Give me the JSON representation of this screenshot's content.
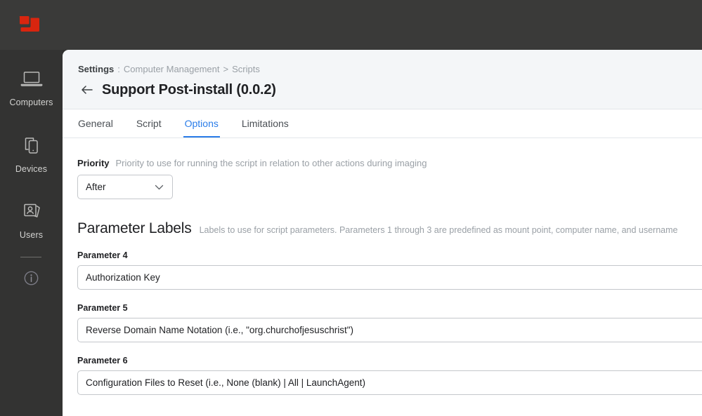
{
  "brand": {
    "logo_icon": "jamf-logo-icon",
    "accent_color": "#d8250f",
    "tab_active_color": "#2b7de9",
    "topbar_color": "#3a3a39",
    "sidebar_color": "#333332"
  },
  "sidebar": {
    "items": [
      {
        "label": "Computers",
        "icon": "laptop-icon"
      },
      {
        "label": "Devices",
        "icon": "mobile-devices-icon"
      },
      {
        "label": "Users",
        "icon": "users-cards-icon"
      }
    ],
    "info_icon": "info-circle-icon"
  },
  "header": {
    "breadcrumb": {
      "root": "Settings",
      "colon": ":",
      "middle": "Computer Management",
      "separator": ">",
      "current": "Scripts"
    },
    "back_icon": "back-arrow-icon",
    "title": "Support Post-install (0.0.2)"
  },
  "tabs": [
    {
      "label": "General",
      "active": false
    },
    {
      "label": "Script",
      "active": false
    },
    {
      "label": "Options",
      "active": true
    },
    {
      "label": "Limitations",
      "active": false
    }
  ],
  "priority": {
    "label": "Priority",
    "note": "Priority to use for running the script in relation to other actions during imaging",
    "value": "After",
    "chevron_icon": "chevron-down-icon"
  },
  "parameter_labels": {
    "title": "Parameter Labels",
    "note": "Labels to use for script parameters. Parameters 1 through 3 are predefined as mount point, computer name, and username",
    "fields": [
      {
        "label": "Parameter 4",
        "value": "Authorization Key",
        "placeholder": ""
      },
      {
        "label": "Parameter 5",
        "value": "Reverse Domain Name Notation (i.e., \"org.churchofjesuschrist\")",
        "placeholder": ""
      },
      {
        "label": "Parameter 6",
        "value": "Configuration Files to Reset (i.e., None (blank) | All | LaunchAgent)",
        "placeholder": ""
      }
    ]
  }
}
